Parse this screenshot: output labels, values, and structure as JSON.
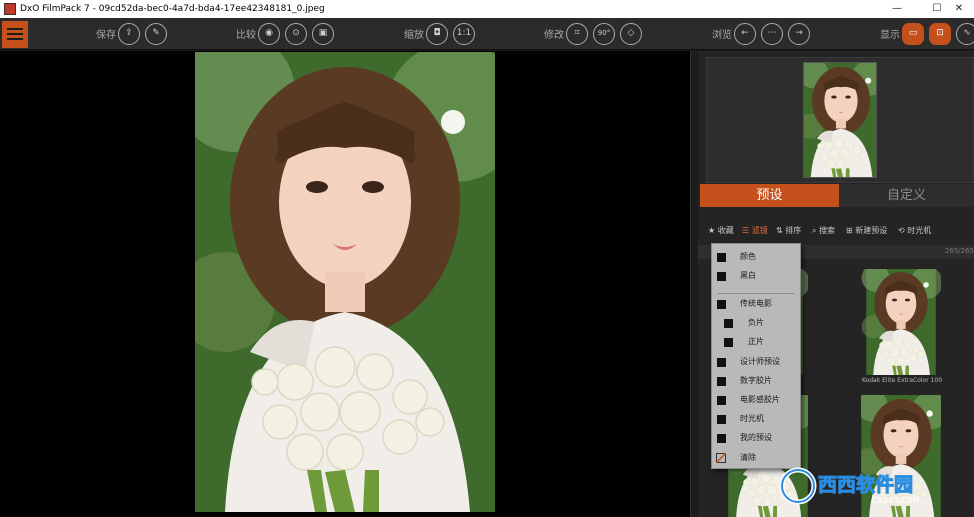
{
  "window": {
    "title": "DxO FilmPack 7 - 09cd52da-bec0-4a7d-bda4-17ee42348181_0.jpeg",
    "minimize": "—",
    "maximize": "☐",
    "close": "✕"
  },
  "toolbar": {
    "save_label": "保存",
    "compare_label": "比较",
    "zoom_label": "缩放",
    "zoom_ratio": "1:1",
    "modify_label": "修改",
    "rotate_value": "90°",
    "browse_label": "浏览",
    "display_label": "显示"
  },
  "panel": {
    "tabs": [
      "预设",
      "自定义"
    ],
    "filters": {
      "favorites": "收藏",
      "filter": "滤镜",
      "sort": "排序",
      "search": "搜索",
      "new_preset": "新建预设",
      "time_machine": "时光机"
    },
    "count": "265/265",
    "tile_caption": "Kodak Elite ExtraColor 100"
  },
  "dropdown": {
    "items": [
      {
        "label": "颜色"
      },
      {
        "label": "黑白"
      },
      {
        "label": "传统电影"
      },
      {
        "label": "负片"
      },
      {
        "label": "正片"
      },
      {
        "label": "设计师预设"
      },
      {
        "label": "数字胶片"
      },
      {
        "label": "电影感胶片"
      },
      {
        "label": "时光机"
      },
      {
        "label": "我的预设"
      },
      {
        "label": "清除"
      }
    ]
  },
  "watermark": {
    "brand": "西西软件园",
    "url": "CR173.COM"
  },
  "colors": {
    "accent": "#c4501c",
    "panel_bg": "#242424",
    "menu_bg": "#b9b9b9"
  }
}
